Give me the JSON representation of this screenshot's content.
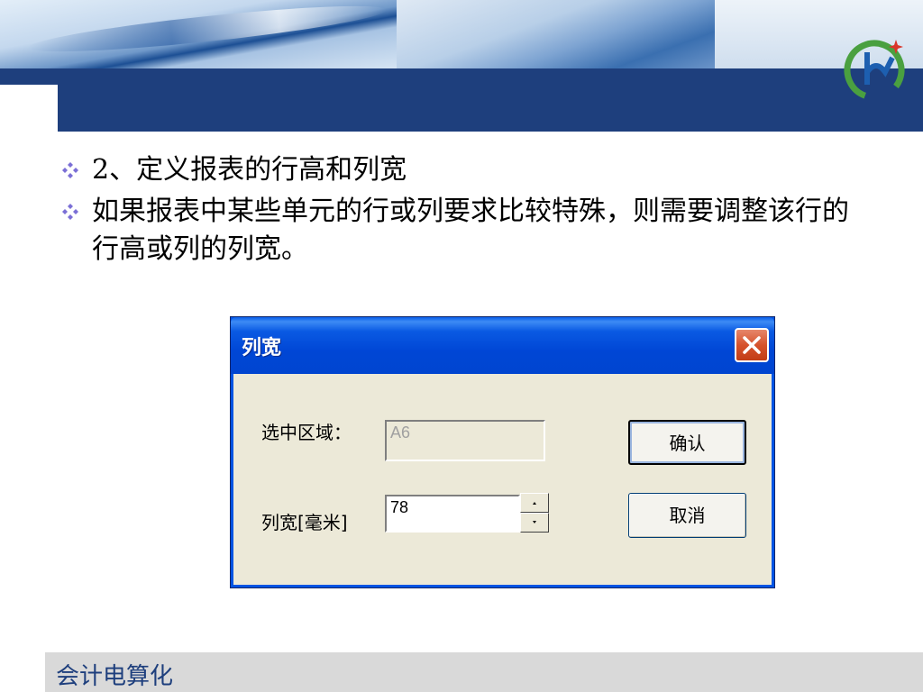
{
  "slide": {
    "bullets": [
      {
        "text": "2、定义报表的行高和列宽"
      },
      {
        "text": "如果报表中某些单元的行或列要求比较特殊，则需要调整该行的行高或列的列宽。"
      }
    ],
    "footer_text": "会计电算化"
  },
  "dialog": {
    "title": "列宽",
    "selection_label": "选中区域：",
    "selection_value": "A6",
    "width_label": "列宽[毫米]",
    "width_value": "78",
    "ok_label": "确认",
    "cancel_label": "取消"
  },
  "colors": {
    "header_navy": "#1e3f7d",
    "titlebar_blue": "#0046d5",
    "dialog_bg": "#ece9d8",
    "bullet_mark": "#7b6fd6",
    "logo_green": "#4aa040",
    "logo_blue": "#1d5fb0"
  }
}
